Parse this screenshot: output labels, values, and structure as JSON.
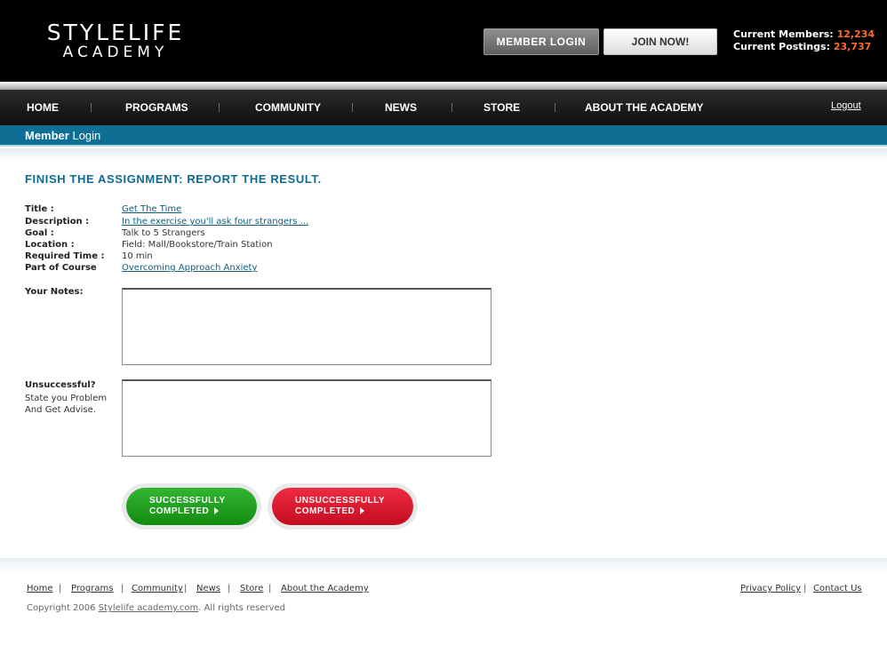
{
  "header": {
    "logo_line1": "STYLELIFE",
    "logo_line2": "ACADEMY",
    "member_login_button": "MEMBER  LOGIN",
    "join_button": "JOIN NOW!",
    "stats": {
      "members_label": "Current Members:",
      "members_value": "12,234",
      "postings_label": "Current Postings:",
      "postings_value": "23,737"
    }
  },
  "nav": {
    "items": [
      "HOME",
      "PROGRAMS",
      "COMMUNITY",
      "NEWS",
      "STORE",
      "ABOUT THE ACADEMY"
    ],
    "logout": "Logout"
  },
  "subbar": {
    "title_bold": "Member",
    "title_rest": " Login"
  },
  "assignment": {
    "heading": "FINISH THE ASSIGNMENT: REPORT THE RESULT.",
    "fields": {
      "title_label": "Title :",
      "title_value": "Get The Time",
      "description_label": "Description :",
      "description_value": "In the exercise you'll ask four strangers ...",
      "goal_label": "Goal :",
      "goal_value": "Talk to 5 Strangers",
      "location_label": "Location :",
      "location_value": "Field: Mall/Bookstore/Train Station",
      "time_label": "Required Time :",
      "time_value": "10 min",
      "course_label": "Part of Course",
      "course_value": "Overcoming Approach Anxiety"
    },
    "notes_label": "Your Notes:",
    "notes_value": "",
    "unsuccessful_label": "Unsuccessful?",
    "unsuccessful_line2": "State you Problem",
    "unsuccessful_line3": "And Get Advise.",
    "problem_value": "",
    "success_button_line1": "SUCCESSFULLY",
    "success_button_line2": "COMPLETED",
    "fail_button_line1": "UNSUCCESSFULLY",
    "fail_button_line2": "COMPLETED"
  },
  "footer": {
    "links": [
      "Home",
      "Programs",
      "Community",
      "News",
      "Store",
      "About the Academy"
    ],
    "right_links": [
      "Privacy Policy",
      "Contact Us"
    ],
    "copyright_prefix": "Copyright 2006 ",
    "copyright_link": "Stylelife academy.com",
    "copyright_suffix": ".  All rights reserved"
  },
  "colors": {
    "accent_blue": "#0e6e94",
    "stat_orange": "#ff6a2b",
    "success_green": "#1f9e1d",
    "fail_red": "#d91a2e"
  }
}
